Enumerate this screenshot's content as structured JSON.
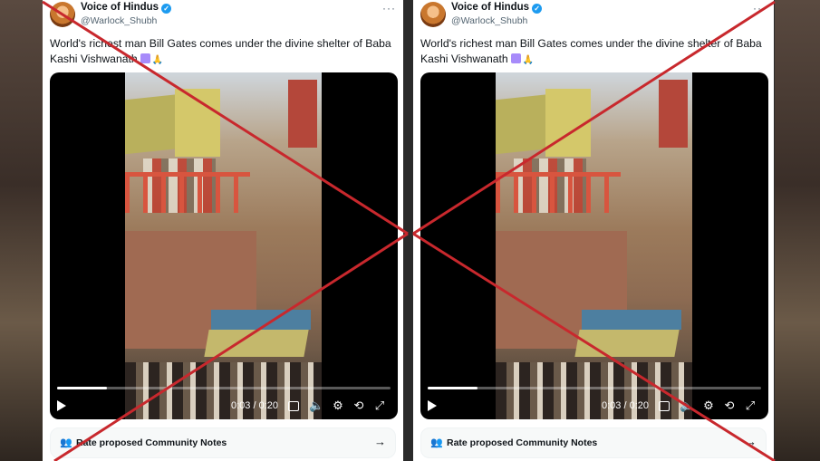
{
  "colors": {
    "cross": "#c8282d",
    "accent": "#1d9bf0",
    "verified": "#1d9bf0"
  },
  "posts": [
    {
      "author": "Voice of Hindus",
      "handle": "@Warlock_Shubh",
      "more": "···",
      "text": "World's richest man Bill Gates comes under the divine shelter of Baba Kashi Vishwanath",
      "video": {
        "time": "0:03 / 0:20",
        "progress": 0.15
      },
      "notes_label": "Rate proposed Community Notes",
      "icons": {
        "verified": "verified-badge",
        "notes": "people-icon",
        "arrow": "arrow-right-icon"
      }
    },
    {
      "author": "Voice of Hindus",
      "handle": "@Warlock_Shubh",
      "more": "···",
      "text": "World's richest man Bill Gates comes under the divine shelter of Baba Kashi Vishwanath",
      "video": {
        "time": "0:03 / 0:20",
        "progress": 0.15
      },
      "notes_label": "Rate proposed Community Notes",
      "icons": {
        "verified": "verified-badge",
        "notes": "people-icon",
        "arrow": "arrow-right-icon"
      }
    }
  ]
}
